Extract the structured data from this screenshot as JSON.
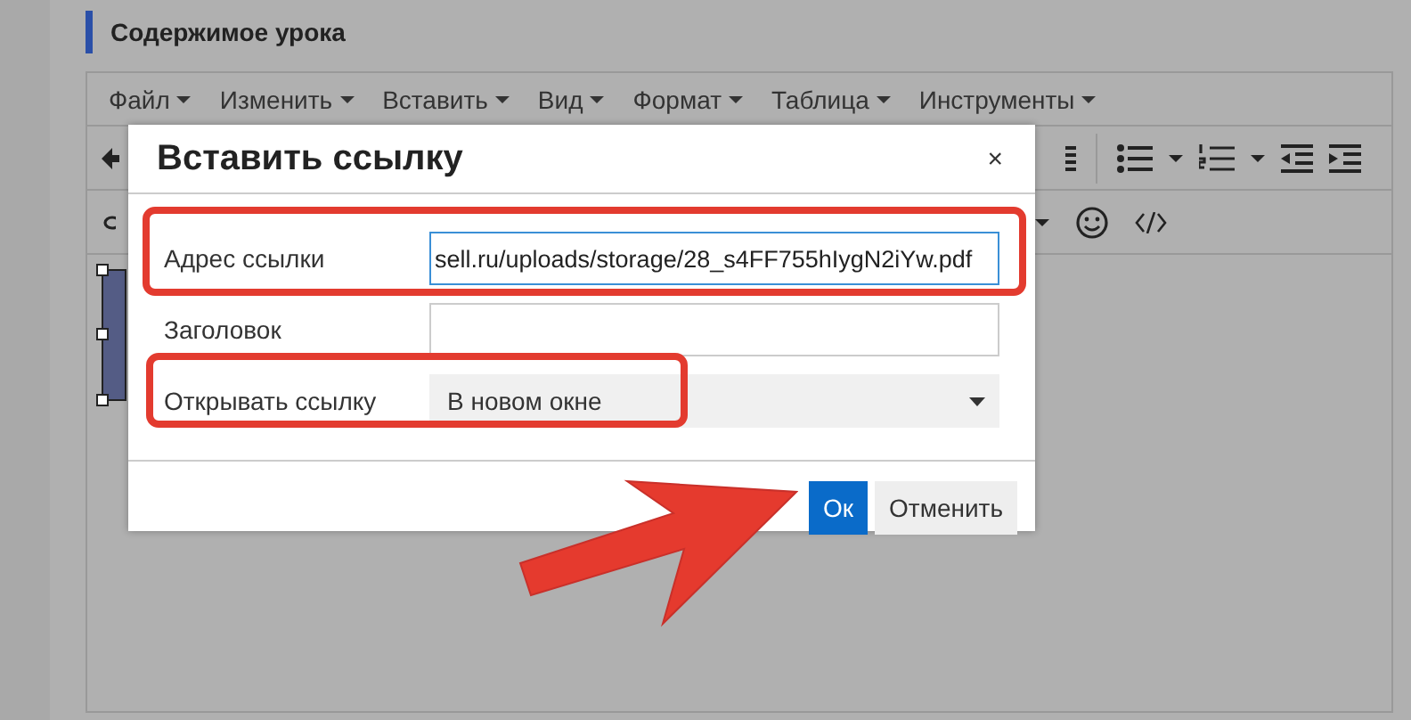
{
  "page_title": "Содержимое урока",
  "menu": [
    {
      "label": "Файл"
    },
    {
      "label": "Изменить"
    },
    {
      "label": "Вставить"
    },
    {
      "label": "Вид"
    },
    {
      "label": "Формат"
    },
    {
      "label": "Таблица"
    },
    {
      "label": "Инструменты"
    }
  ],
  "dialog": {
    "title": "Вставить ссылку",
    "close": "×",
    "fields": [
      {
        "kind": "text",
        "label": "Адрес ссылки",
        "value": "sell.ru/uploads/storage/28_s4FF755hIygN2iYw.pdf",
        "focused": true,
        "highlighted": true
      },
      {
        "kind": "text",
        "label": "Заголовок",
        "focused": false
      },
      {
        "kind": "select",
        "label": "Открывать ссылку",
        "value": "В новом окне",
        "highlighted": true
      }
    ],
    "buttons": [
      {
        "label": "Ок",
        "primary": true
      },
      {
        "label": "Отменить",
        "primary": false
      }
    ]
  }
}
